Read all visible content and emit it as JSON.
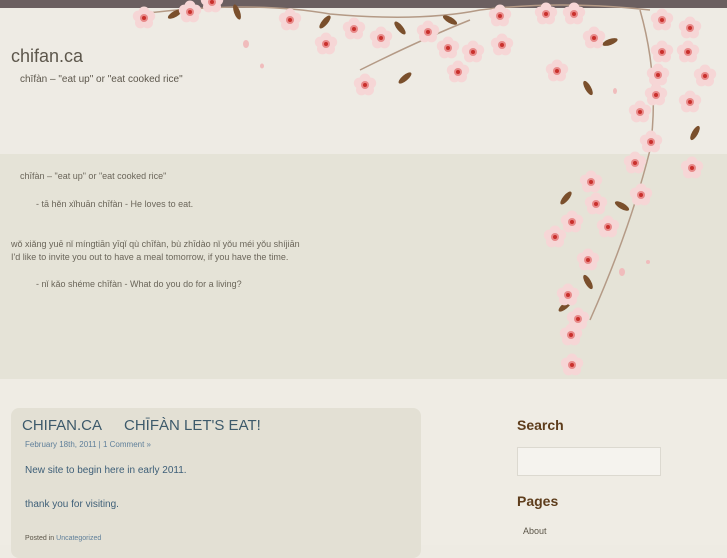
{
  "site": {
    "title": "chifan.ca",
    "tagline": "chīfàn – \"eat up\" or \"eat cooked rice\""
  },
  "band": {
    "lines": [
      "chīfàn – \"eat up\" or \"eat cooked rice\"",
      "- tā hěn xǐhuān chīfàn - He loves to eat.",
      "wǒ xiǎng yuē nǐ míngtiān yīqǐ qù chīfàn, bù zhīdào nǐ yǒu méi yǒu shíjiān",
      "I'd like to invite you out to have a meal tomorrow, if you have the time.",
      "- nǐ kǎo shéme chīfàn - What do you do for a living?"
    ]
  },
  "post": {
    "title_left": "CHIFAN.CA",
    "title_right": "CHĪFÀN LET'S EAT!",
    "date": "February 18th, 2011",
    "separator": " | ",
    "comments": "1 Comment »",
    "body": [
      "New site to begin here in early 2011.",
      "thank you for visiting."
    ],
    "footer_prefix": "Posted in ",
    "category": "Uncategorized"
  },
  "sidebar": {
    "search_title": "Search",
    "pages_title": "Pages",
    "pages": [
      "About"
    ]
  },
  "colors": {
    "topbar": "#6b5f60",
    "band": "#e5e3d7",
    "link": "#5f7f9a",
    "widget_title": "#5e3d1c",
    "blossom": "#f4cccc",
    "blossom_center": "#d9534f",
    "branch": "#6e4a2d"
  }
}
